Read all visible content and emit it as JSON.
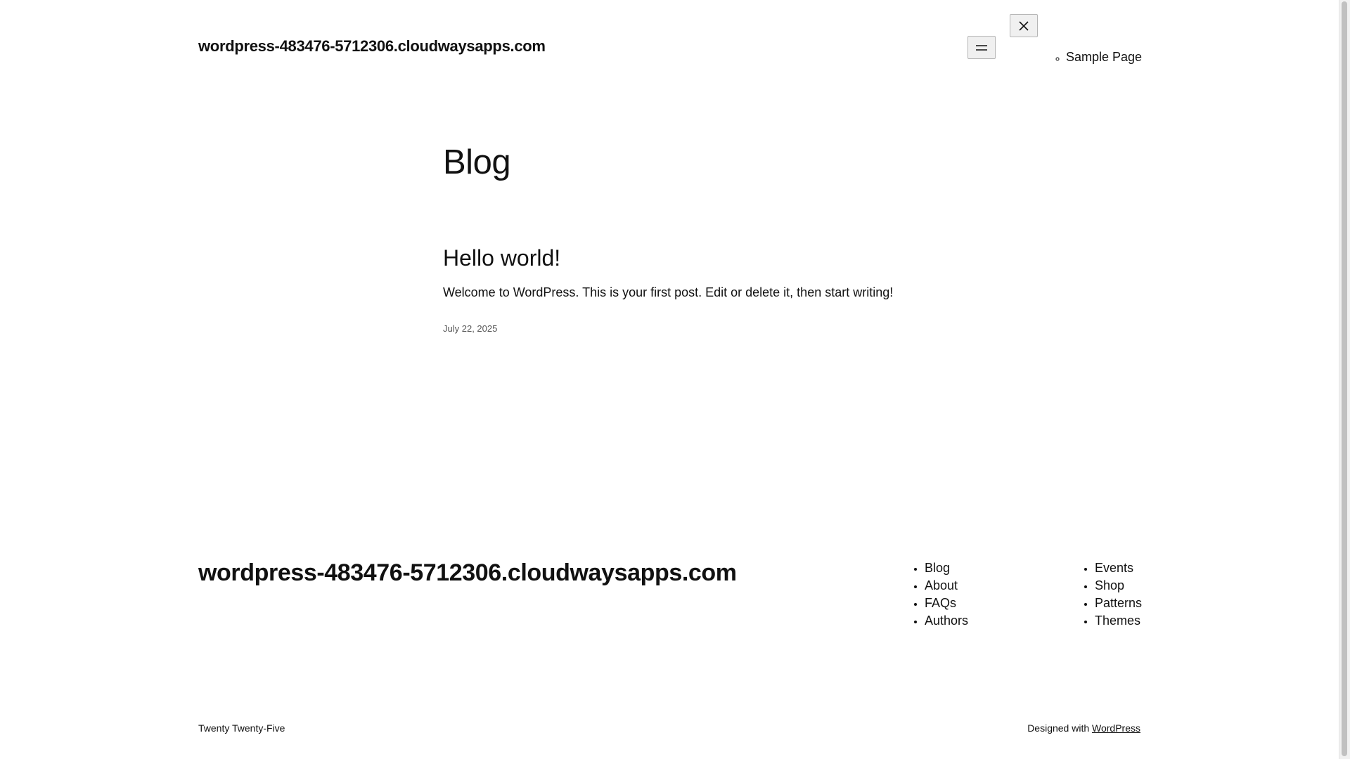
{
  "header": {
    "site_title": "wordpress-483476-5712306.cloudwaysapps.com",
    "open_menu_icon": "hamburger-menu-icon",
    "close_menu_icon": "close-icon",
    "nav_items": [
      {
        "label": "Sample Page"
      }
    ]
  },
  "main": {
    "page_title": "Blog",
    "posts": [
      {
        "title": "Hello world!",
        "excerpt": "Welcome to WordPress. This is your first post. Edit or delete it, then start writing!",
        "date": "July 22, 2025"
      }
    ]
  },
  "footer": {
    "site_title": "wordpress-483476-5712306.cloudwaysapps.com",
    "nav_left": [
      {
        "label": "Blog"
      },
      {
        "label": "About"
      },
      {
        "label": "FAQs"
      },
      {
        "label": "Authors"
      }
    ],
    "nav_right": [
      {
        "label": "Events"
      },
      {
        "label": "Shop"
      },
      {
        "label": "Patterns"
      },
      {
        "label": "Themes"
      }
    ],
    "theme_name": "Twenty Twenty-Five",
    "designed_with_prefix": "Designed with ",
    "designed_with_link": "WordPress"
  },
  "colors": {
    "text": "#111111",
    "background": "#ffffff",
    "muted": "#555555"
  }
}
